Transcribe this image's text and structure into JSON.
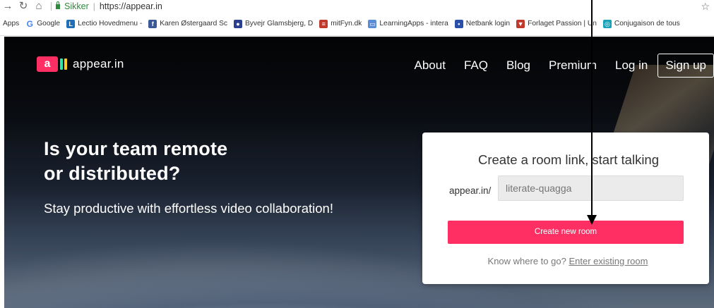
{
  "browser": {
    "secure_label": "Sikker",
    "url": "https://appear.in"
  },
  "bookmarks": [
    {
      "label": "Apps",
      "icon": "apps-grid-icon",
      "color": "#4285f4"
    },
    {
      "label": "Google",
      "icon": "google-icon",
      "color": "#4285f4"
    },
    {
      "label": "Lectio Hovedmenu -",
      "icon": "lectio-icon",
      "color": "#1e6fb8"
    },
    {
      "label": "Karen Østergaard Sc",
      "icon": "facebook-icon",
      "color": "#3b5998"
    },
    {
      "label": "Byvejr Glamsbjerg, D",
      "icon": "weather-icon",
      "color": "#2a3f8f"
    },
    {
      "label": "mitFyn.dk",
      "icon": "mitfyn-icon",
      "color": "#c0392b"
    },
    {
      "label": "LearningApps - intera",
      "icon": "learningapps-icon",
      "color": "#5b8dd6"
    },
    {
      "label": "Netbank login",
      "icon": "netbank-icon",
      "color": "#2a4fa8"
    },
    {
      "label": "Forlaget Passion | Un",
      "icon": "forlaget-icon",
      "color": "#c0392b"
    },
    {
      "label": "Conjugaison de tous",
      "icon": "conjugaison-icon",
      "color": "#17a2b8"
    }
  ],
  "header": {
    "logo_letter": "a",
    "logo_text": "appear.in",
    "nav": [
      "About",
      "FAQ",
      "Blog",
      "Premium",
      "Log in"
    ],
    "signup": "Sign up"
  },
  "hero": {
    "headline_line1": "Is your team remote",
    "headline_line2": "or distributed?",
    "subline": "Stay productive with effortless video collaboration!"
  },
  "card": {
    "title": "Create a room link, start talking",
    "prefix": "appear.in/",
    "input_placeholder": "literate-quagga",
    "create_button": "Create new room",
    "existing_prompt": "Know where to go?",
    "existing_link": "Enter existing room"
  },
  "colors": {
    "brand_pink": "#ff2e63",
    "logo_green": "#2ee6a8",
    "logo_yellow": "#ffcc2e",
    "secure_green": "#2e8b3d"
  }
}
